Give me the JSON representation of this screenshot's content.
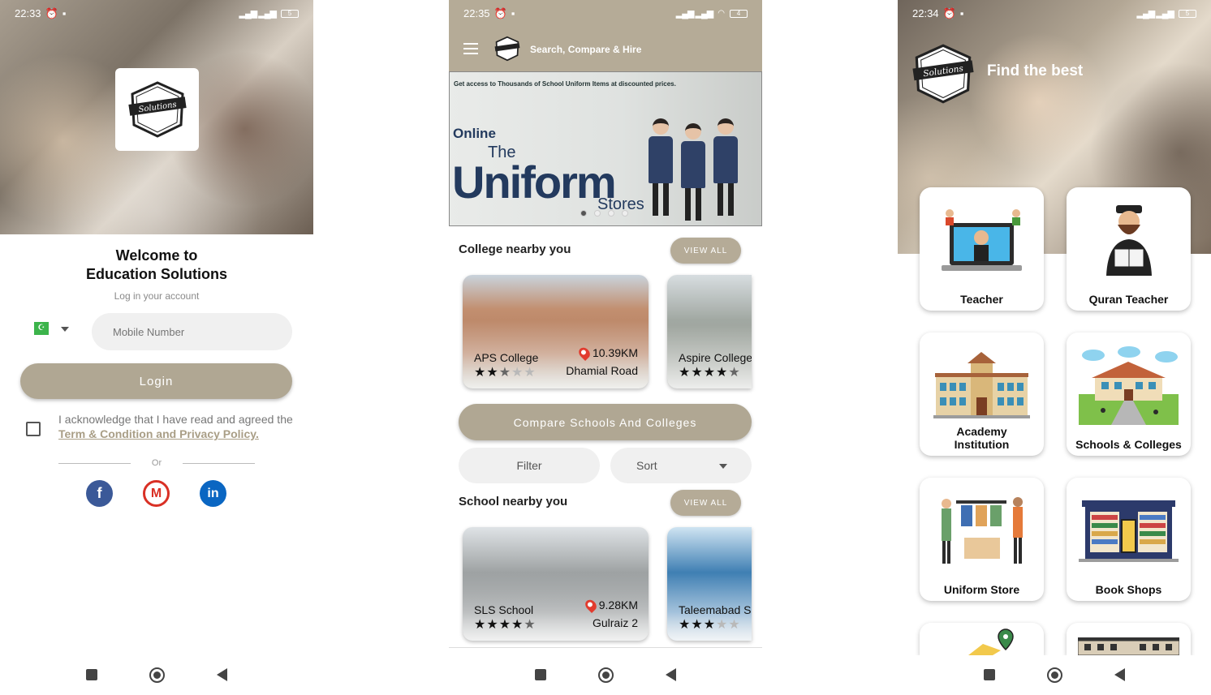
{
  "screen1": {
    "status": {
      "time": "22:33",
      "battery": "5"
    },
    "welcome_line1": "Welcome to",
    "welcome_line2": "Education Solutions",
    "subtitle": "Log in your account",
    "mobile_placeholder": "Mobile Number",
    "login_label": "Login",
    "ack_text": "I acknowledge that I have read and agreed the",
    "ack_link": " Term & Condition and Privacy Policy.",
    "or_label": "Or",
    "social": {
      "facebook": "f",
      "gmail": "M",
      "linkedin": "in"
    }
  },
  "screen2": {
    "status": {
      "time": "22:35",
      "battery": "4"
    },
    "header_title": "Search, Compare & Hire",
    "banner": {
      "top_text": "Get access to Thousands of School Uniform Items at discounted prices.",
      "online": "Online",
      "the": "The",
      "uniform": "Uniform",
      "stores": "Stores"
    },
    "college_section": {
      "title": "College nearby you",
      "view_all": "VIEW ALL",
      "cards": [
        {
          "name": "APS College",
          "distance": "10.39KM",
          "area": "Dhamial Road",
          "rating": 2.5
        },
        {
          "name": "Aspire College",
          "rating": 4.5
        }
      ]
    },
    "compare_label": "Compare Schools And Colleges",
    "filter_label": "Filter",
    "sort_label": "Sort",
    "school_section": {
      "title": "School nearby you",
      "view_all": "VIEW ALL",
      "cards": [
        {
          "name": "SLS School",
          "distance": "9.28KM",
          "area": "Gulraiz 2",
          "rating": 4.5
        },
        {
          "name": "Taleemabad S",
          "rating": 3
        }
      ]
    }
  },
  "screen3": {
    "status": {
      "time": "22:34",
      "battery": "5"
    },
    "headline": "Find the best",
    "categories": [
      {
        "label": "Teacher",
        "icon": "teacher-laptop-icon"
      },
      {
        "label": "Quran Teacher",
        "icon": "quran-teacher-icon"
      },
      {
        "label": "Academy\nInstitution",
        "icon": "academy-building-icon"
      },
      {
        "label": "Schools & Colleges",
        "icon": "school-building-icon"
      },
      {
        "label": "Uniform Store",
        "icon": "uniform-store-icon"
      },
      {
        "label": "Book Shops",
        "icon": "book-shop-icon"
      }
    ]
  },
  "colors": {
    "accent": "#b5ab97",
    "button": "#b0a793",
    "facebook": "#3b5998",
    "gmail": "#d93025",
    "linkedin": "#0a66c2",
    "pin": "#e23b2e"
  }
}
